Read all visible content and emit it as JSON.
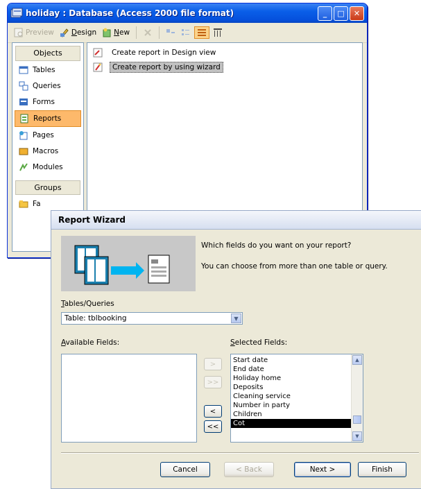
{
  "db_window": {
    "title": "holiday : Database (Access 2000 file format)",
    "toolbar": {
      "preview": "Preview",
      "design": "Design",
      "new": "New"
    },
    "objects_header": "Objects",
    "objects": [
      "Tables",
      "Queries",
      "Forms",
      "Reports",
      "Pages",
      "Macros",
      "Modules"
    ],
    "groups_header": "Groups",
    "groups_item": "Fa",
    "list": [
      "Create report in Design view",
      "Create report by using wizard"
    ]
  },
  "wizard": {
    "title": "Report Wizard",
    "prompt_main": "Which fields do you want on your report?",
    "prompt_sub": "You can choose from more than one table or query.",
    "tables_label": "Tables/Queries",
    "tables_value": "Table: tblbooking",
    "available_label": "Available Fields:",
    "selected_label": "Selected Fields:",
    "move_buttons": [
      ">",
      ">>",
      "<",
      "<<"
    ],
    "selected_fields": [
      "Start date",
      "End date",
      "Holiday home",
      "Deposits",
      "Cleaning service",
      "Number in party",
      "Children",
      "Cot"
    ],
    "selected_index": 7,
    "buttons": {
      "cancel": "Cancel",
      "back": "< Back",
      "next": "Next >",
      "finish": "Finish"
    }
  },
  "colors": {
    "title_blue": "#0a5fe8",
    "selected_orange": "#fdb96b",
    "list_selected": "#000000"
  }
}
